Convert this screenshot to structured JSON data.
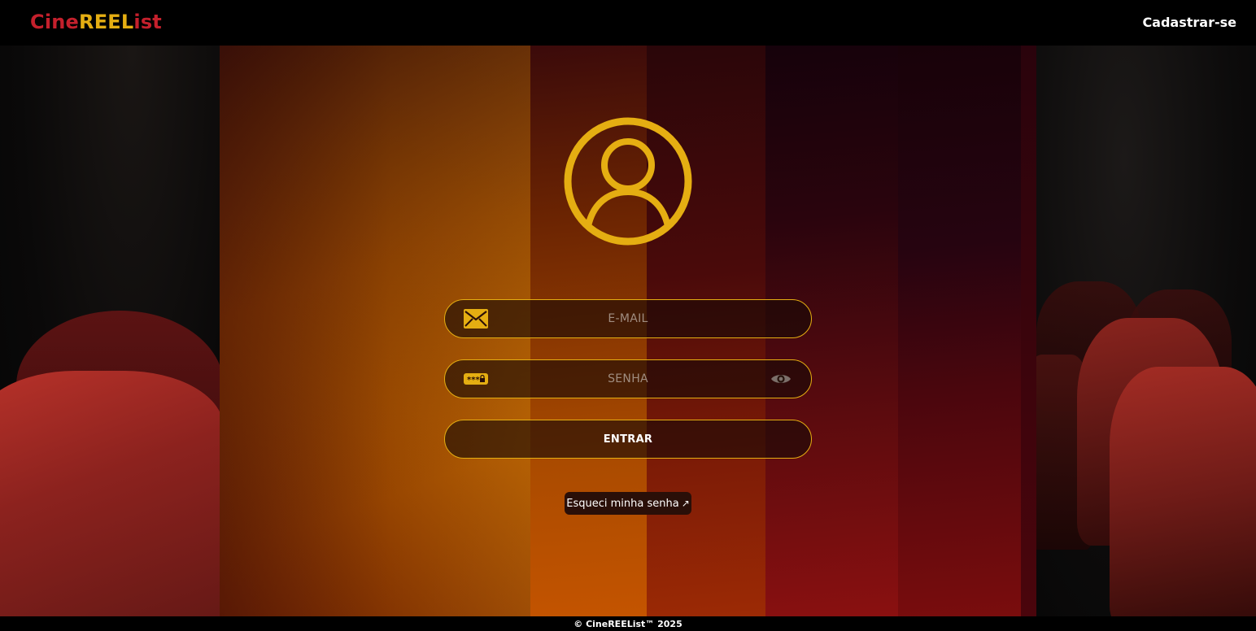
{
  "header": {
    "logo": {
      "part1": "Cine",
      "part2": "REEL",
      "part3": "ist"
    },
    "signup_label": "Cadastrar-se"
  },
  "form": {
    "email_placeholder": "E-MAIL",
    "password_placeholder": "SENHA",
    "submit_label": "ENTRAR",
    "forgot_label": "Esqueci minha senha",
    "forgot_arrow": "↗"
  },
  "footer": {
    "text": "© CineREEList™ 2025"
  },
  "icons": {
    "avatar": "user-circle-icon",
    "email": "envelope-icon",
    "password": "password-keys-icon",
    "toggle": "eye-icon"
  },
  "colors": {
    "brand_red": "#c4202c",
    "brand_gold": "#e5ae12",
    "accent_border": "#e5ae12",
    "background": "#000000"
  }
}
